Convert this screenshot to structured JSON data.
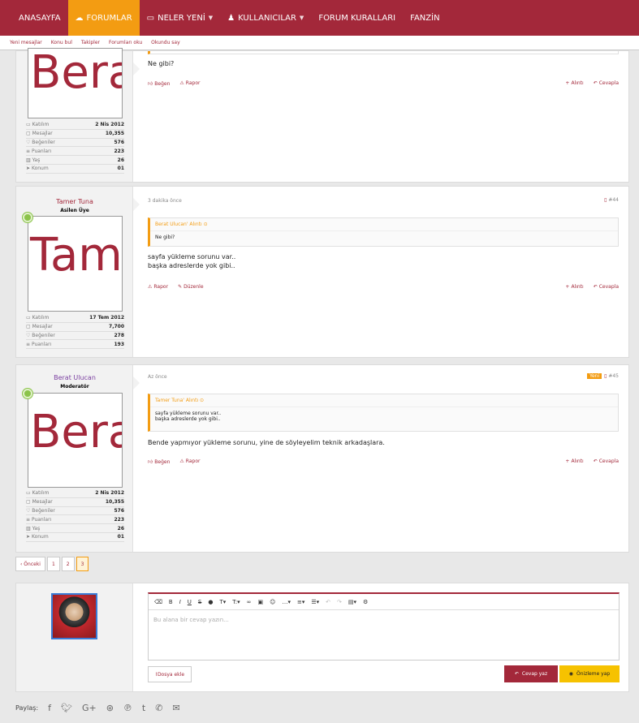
{
  "nav": {
    "items": [
      "ANASAYFA",
      "FORUMLAR",
      "NELER YENİ",
      "KULLANICILAR",
      "FORUM KURALLARI",
      "FANZİN"
    ]
  },
  "subnav": [
    "Yeni mesajlar",
    "Konu bul",
    "Takipler",
    "Forumları oku",
    "Okundu say"
  ],
  "posts": [
    {
      "avatar_text": "Bera",
      "stats": [
        [
          "Katılım",
          "2 Nis 2012"
        ],
        [
          "Mesajlar",
          "10,355"
        ],
        [
          "Beğeniler",
          "576"
        ],
        [
          "Puanları",
          "223"
        ],
        [
          "Yaş",
          "26"
        ],
        [
          "Konum",
          "01"
        ]
      ],
      "message": "Ne gibi?",
      "actions_left": [
        "Beğen",
        "Rapor"
      ],
      "actions_right": [
        "Alıntı",
        "Cevapla"
      ]
    },
    {
      "username": "Tamer Tuna",
      "user_title": "Asilen Üye",
      "avatar_text": "Tam",
      "stats": [
        [
          "Katılım",
          "17 Tem 2012"
        ],
        [
          "Mesajlar",
          "7,700"
        ],
        [
          "Beğeniler",
          "278"
        ],
        [
          "Puanları",
          "193"
        ]
      ],
      "time": "3 dakika önce",
      "number": "#44",
      "quote_header": "Berat Ulucan' Alıntı",
      "quote_body": "Ne gibi?",
      "message_lines": [
        "sayfa yükleme sorunu var..",
        "başka adreslerde yok gibi.."
      ],
      "actions_left": [
        "Rapor",
        "Düzenle"
      ],
      "actions_right": [
        "Alıntı",
        "Cevapla"
      ]
    },
    {
      "username": "Berat Ulucan",
      "user_title": "Moderatör",
      "avatar_text": "Bera",
      "stats": [
        [
          "Katılım",
          "2 Nis 2012"
        ],
        [
          "Mesajlar",
          "10,355"
        ],
        [
          "Beğeniler",
          "576"
        ],
        [
          "Puanları",
          "223"
        ],
        [
          "Yaş",
          "26"
        ],
        [
          "Konum",
          "01"
        ]
      ],
      "time": "Az önce",
      "badge": "Yeni",
      "number": "#45",
      "quote_header": "Tamer Tuna' Alıntı",
      "quote_body_lines": [
        "sayfa yükleme sorunu var..",
        "başka adreslerde yok gibi.."
      ],
      "message": "Bende yapmıyor yükleme sorunu, yine de söyleyelim teknik arkadaşlara.",
      "actions_left": [
        "Beğen",
        "Rapor"
      ],
      "actions_right": [
        "Alıntı",
        "Cevapla"
      ]
    }
  ],
  "pager": {
    "prev": "‹ Önceki",
    "pages": [
      "1",
      "2",
      "3"
    ],
    "current": "3"
  },
  "reply": {
    "placeholder": "Bu alana bir cevap yazın...",
    "attach": "Dosya ekle",
    "reply_btn": "Cevap yaz",
    "preview_btn": "Önizleme yap"
  },
  "share": {
    "label": "Paylaş:"
  },
  "colors": {
    "brand": "#a3283a",
    "accent": "#f39c12",
    "online": "#8bc34a"
  }
}
